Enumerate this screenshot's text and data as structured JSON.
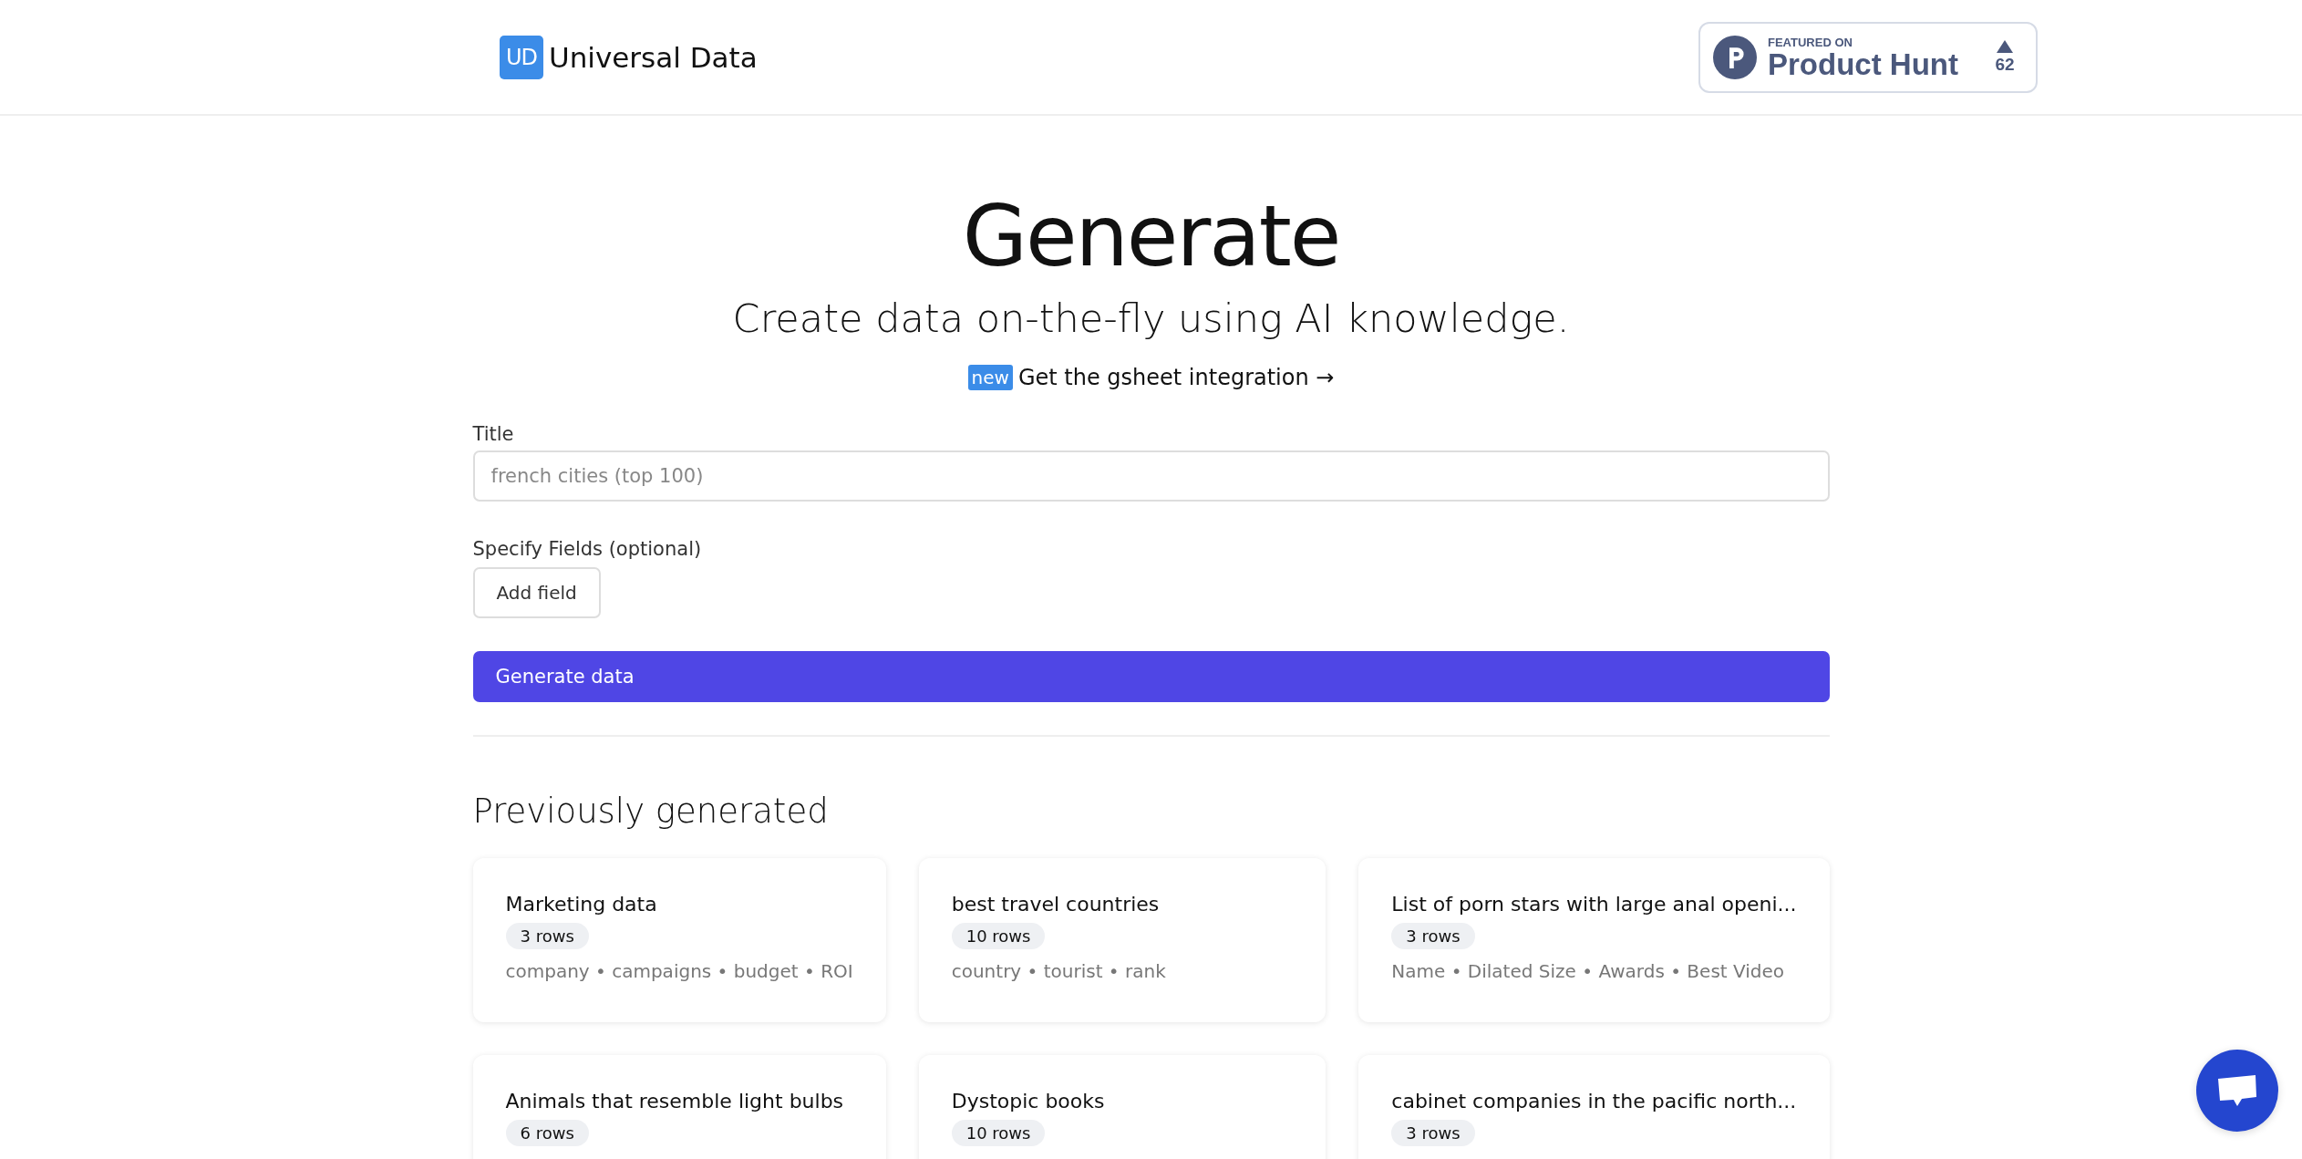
{
  "header": {
    "logo_mark": "UD",
    "brand": "Universal Data",
    "badge": {
      "featured": "FEATURED ON",
      "name": "Product Hunt",
      "votes": "62"
    }
  },
  "hero": {
    "title": "Generate",
    "subtitle": "Create data on-the-fly using AI knowledge.",
    "tag": "new",
    "link": "Get the gsheet integration →"
  },
  "form": {
    "title_label": "Title",
    "title_placeholder": "french cities (top 100)",
    "fields_label": "Specify Fields (optional)",
    "add_button": "Add field",
    "submit_button": "Generate data"
  },
  "previous": {
    "heading": "Previously generated",
    "cards": [
      {
        "title": "Marketing data",
        "rows": "3 rows",
        "fields": "company • campaigns • budget • ROI"
      },
      {
        "title": "best travel countries",
        "rows": "10 rows",
        "fields": "country • tourist • rank"
      },
      {
        "title": "List of porn stars with large anal openi...",
        "rows": "3 rows",
        "fields": "Name • Dilated Size • Awards • Best Video"
      },
      {
        "title": "Animals that resemble light bulbs",
        "rows": "6 rows"
      },
      {
        "title": "Dystopic books",
        "rows": "10 rows"
      },
      {
        "title": "cabinet companies in the pacific north...",
        "rows": "3 rows"
      }
    ]
  }
}
